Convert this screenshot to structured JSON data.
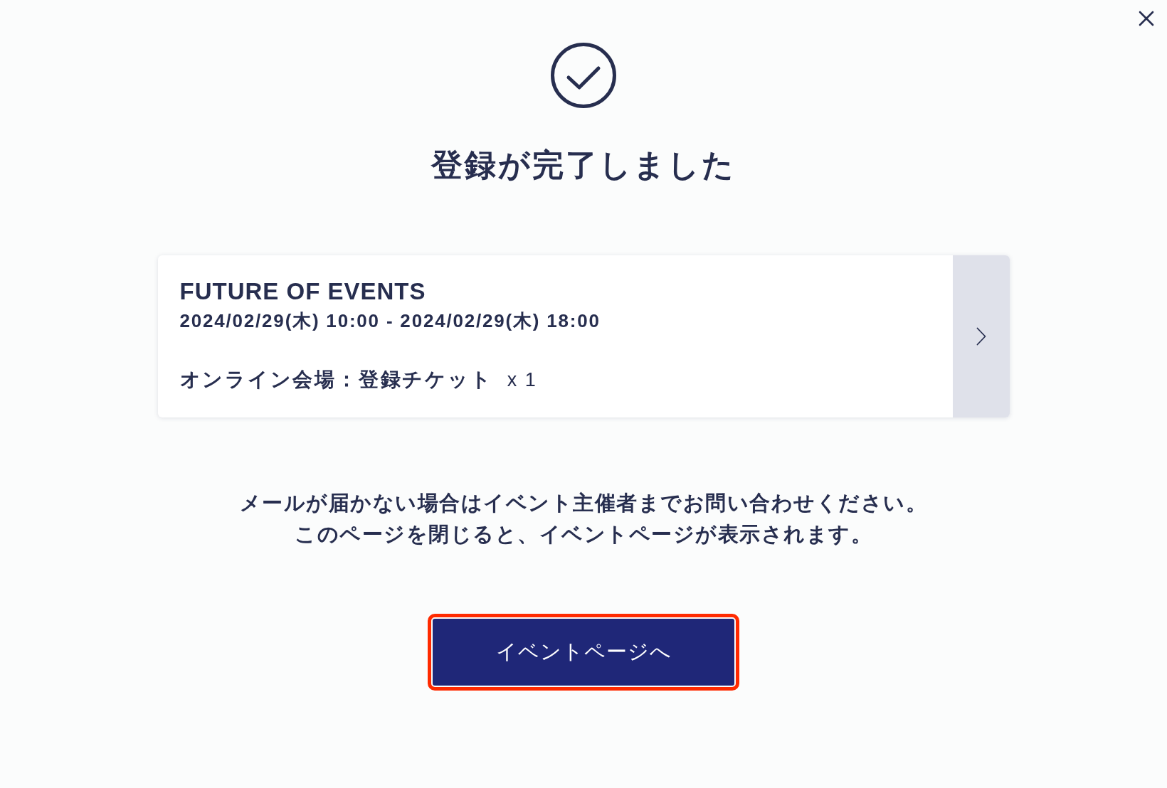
{
  "status": {
    "title": "登録が完了しました"
  },
  "event_card": {
    "title": "FUTURE OF EVENTS",
    "datetime": "2024/02/29(木) 10:00 - 2024/02/29(木) 18:00",
    "ticket": "オンライン会場：登録チケット",
    "quantity": "x 1"
  },
  "message": [
    "メールが届かない場合はイベント主催者までお問い合わせください。",
    "このページを閉じると、イベントページが表示されます。"
  ],
  "button": {
    "label": "イベントページへ",
    "highlighted": true
  }
}
